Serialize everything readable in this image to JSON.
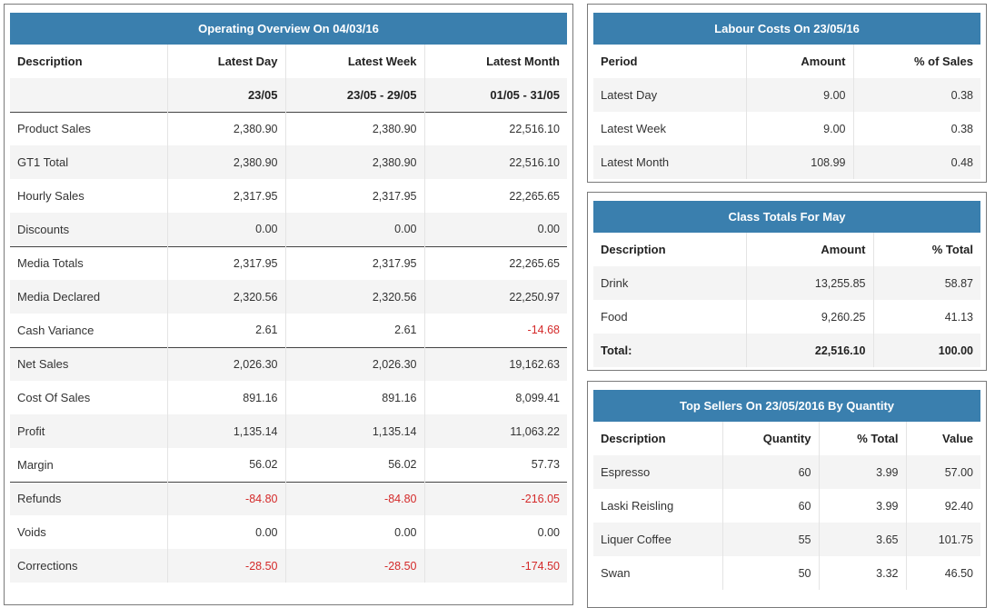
{
  "overview": {
    "title": "Operating Overview On 04/03/16",
    "columns": [
      "Description",
      "Latest Day",
      "Latest Week",
      "Latest Month"
    ],
    "ranges": [
      "",
      "23/05",
      "23/05 - 29/05",
      "01/05 - 31/05"
    ],
    "rows": [
      {
        "label": "Product Sales",
        "day": "2,380.90",
        "week": "2,380.90",
        "month": "22,516.10",
        "neg": [
          false,
          false,
          false
        ],
        "line": false
      },
      {
        "label": "GT1 Total",
        "day": "2,380.90",
        "week": "2,380.90",
        "month": "22,516.10",
        "neg": [
          false,
          false,
          false
        ],
        "line": false
      },
      {
        "label": "Hourly Sales",
        "day": "2,317.95",
        "week": "2,317.95",
        "month": "22,265.65",
        "neg": [
          false,
          false,
          false
        ],
        "line": false
      },
      {
        "label": "Discounts",
        "day": "0.00",
        "week": "0.00",
        "month": "0.00",
        "neg": [
          false,
          false,
          false
        ],
        "line": false
      },
      {
        "label": "Media Totals",
        "day": "2,317.95",
        "week": "2,317.95",
        "month": "22,265.65",
        "neg": [
          false,
          false,
          false
        ],
        "line": true
      },
      {
        "label": "Media Declared",
        "day": "2,320.56",
        "week": "2,320.56",
        "month": "22,250.97",
        "neg": [
          false,
          false,
          false
        ],
        "line": false
      },
      {
        "label": "Cash Variance",
        "day": "2.61",
        "week": "2.61",
        "month": "-14.68",
        "neg": [
          false,
          false,
          true
        ],
        "line": false
      },
      {
        "label": "Net Sales",
        "day": "2,026.30",
        "week": "2,026.30",
        "month": "19,162.63",
        "neg": [
          false,
          false,
          false
        ],
        "line": true
      },
      {
        "label": "Cost Of Sales",
        "day": "891.16",
        "week": "891.16",
        "month": "8,099.41",
        "neg": [
          false,
          false,
          false
        ],
        "line": false
      },
      {
        "label": "Profit",
        "day": "1,135.14",
        "week": "1,135.14",
        "month": "11,063.22",
        "neg": [
          false,
          false,
          false
        ],
        "line": false
      },
      {
        "label": "Margin",
        "day": "56.02",
        "week": "56.02",
        "month": "57.73",
        "neg": [
          false,
          false,
          false
        ],
        "line": false
      },
      {
        "label": "Refunds",
        "day": "-84.80",
        "week": "-84.80",
        "month": "-216.05",
        "neg": [
          true,
          true,
          true
        ],
        "line": true
      },
      {
        "label": "Voids",
        "day": "0.00",
        "week": "0.00",
        "month": "0.00",
        "neg": [
          false,
          false,
          false
        ],
        "line": false
      },
      {
        "label": "Corrections",
        "day": "-28.50",
        "week": "-28.50",
        "month": "-174.50",
        "neg": [
          true,
          true,
          true
        ],
        "line": false
      }
    ]
  },
  "labour": {
    "title": "Labour Costs On 23/05/16",
    "columns": [
      "Period",
      "Amount",
      "% of Sales"
    ],
    "rows": [
      {
        "label": "Latest Day",
        "amount": "9.00",
        "pct": "0.38"
      },
      {
        "label": "Latest Week",
        "amount": "9.00",
        "pct": "0.38"
      },
      {
        "label": "Latest Month",
        "amount": "108.99",
        "pct": "0.48"
      }
    ]
  },
  "class_totals": {
    "title": "Class Totals For May",
    "columns": [
      "Description",
      "Amount",
      "% Total"
    ],
    "rows": [
      {
        "label": "Drink",
        "amount": "13,255.85",
        "pct": "58.87"
      },
      {
        "label": "Food",
        "amount": "9,260.25",
        "pct": "41.13"
      }
    ],
    "total": {
      "label": "Total:",
      "amount": "22,516.10",
      "pct": "100.00"
    }
  },
  "top_sellers": {
    "title": "Top Sellers On 23/05/2016 By Quantity",
    "columns": [
      "Description",
      "Quantity",
      "% Total",
      "Value"
    ],
    "rows": [
      {
        "label": "Espresso",
        "qty": "60",
        "pct": "3.99",
        "value": "57.00"
      },
      {
        "label": "Laski Reisling",
        "qty": "60",
        "pct": "3.99",
        "value": "92.40"
      },
      {
        "label": "Liquer Coffee",
        "qty": "55",
        "pct": "3.65",
        "value": "101.75"
      },
      {
        "label": "Swan",
        "qty": "50",
        "pct": "3.32",
        "value": "46.50"
      }
    ]
  },
  "colors": {
    "header": "#3a7fae",
    "negative": "#d42a2a",
    "stripe": "#f4f4f4"
  }
}
